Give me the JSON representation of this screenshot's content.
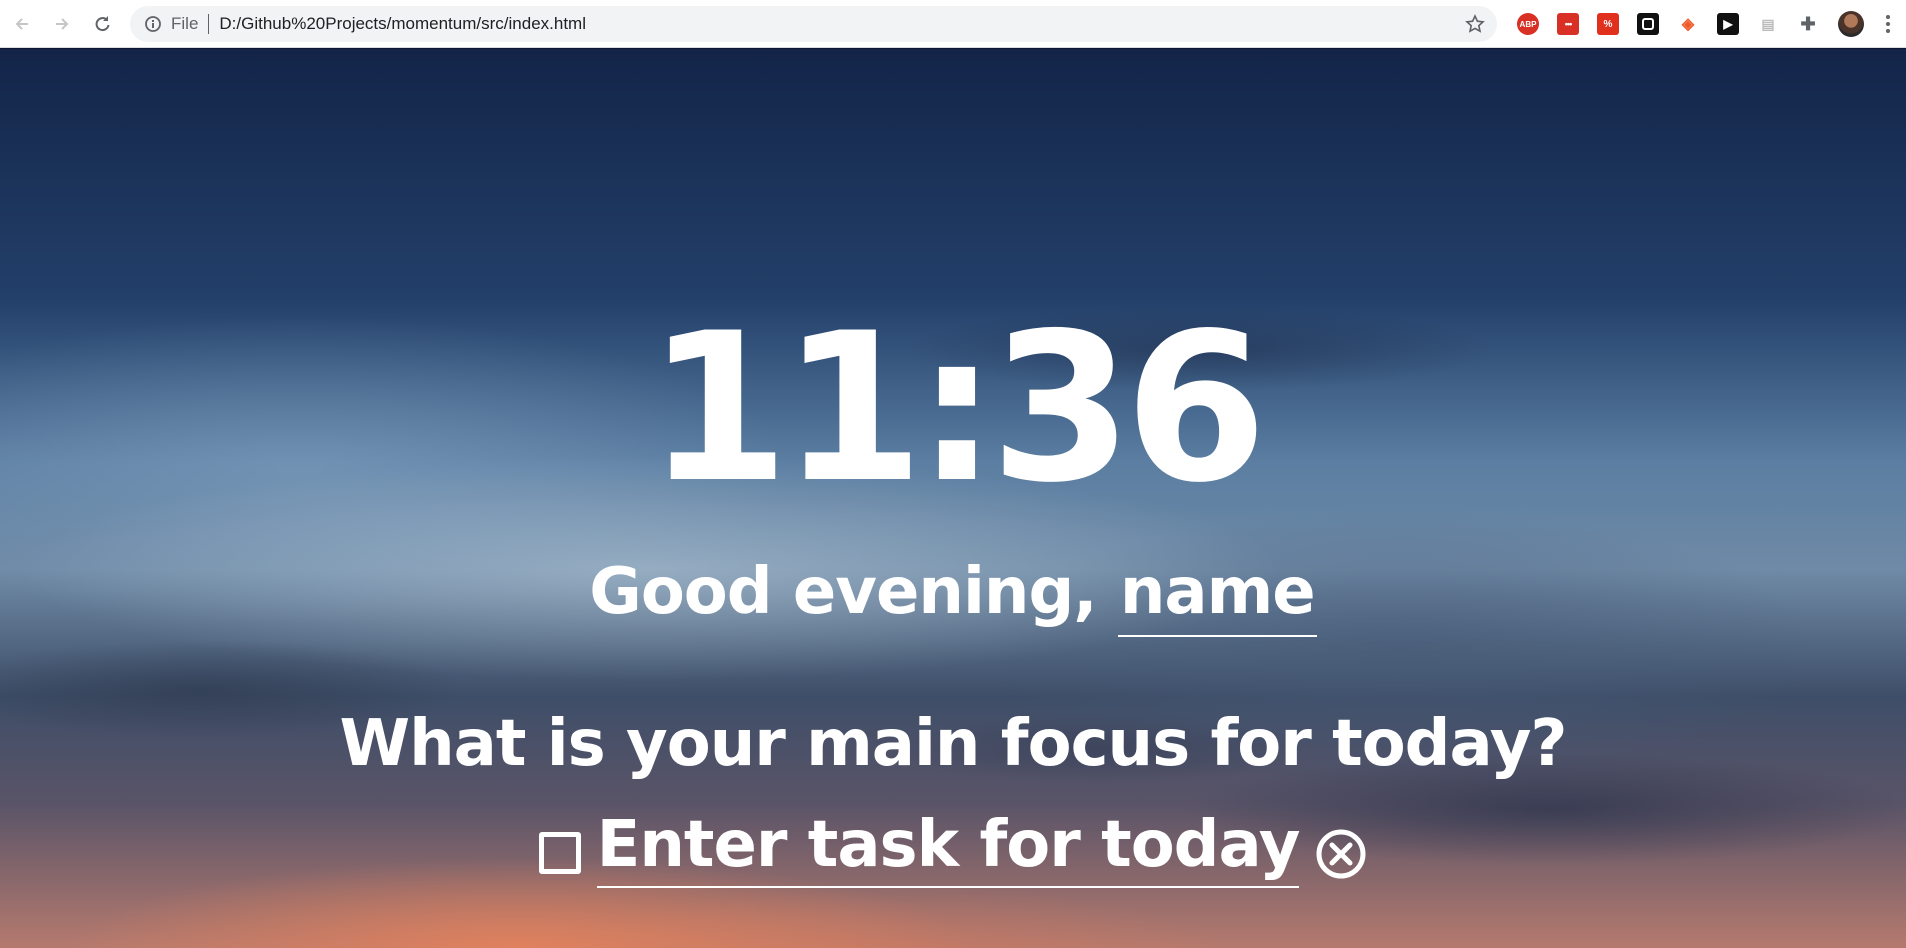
{
  "browser": {
    "scheme_label": "File",
    "url": "D:/Github%20Projects/momentum/src/index.html",
    "extensions": [
      "ABP",
      "•••",
      "%",
      "",
      "◈",
      "▶",
      "",
      ""
    ]
  },
  "app": {
    "time": "11:36",
    "greeting_prefix": "Good evening, ",
    "name": "name",
    "focus_question": "What is your main focus for today?",
    "task_placeholder": "Enter task for today"
  }
}
